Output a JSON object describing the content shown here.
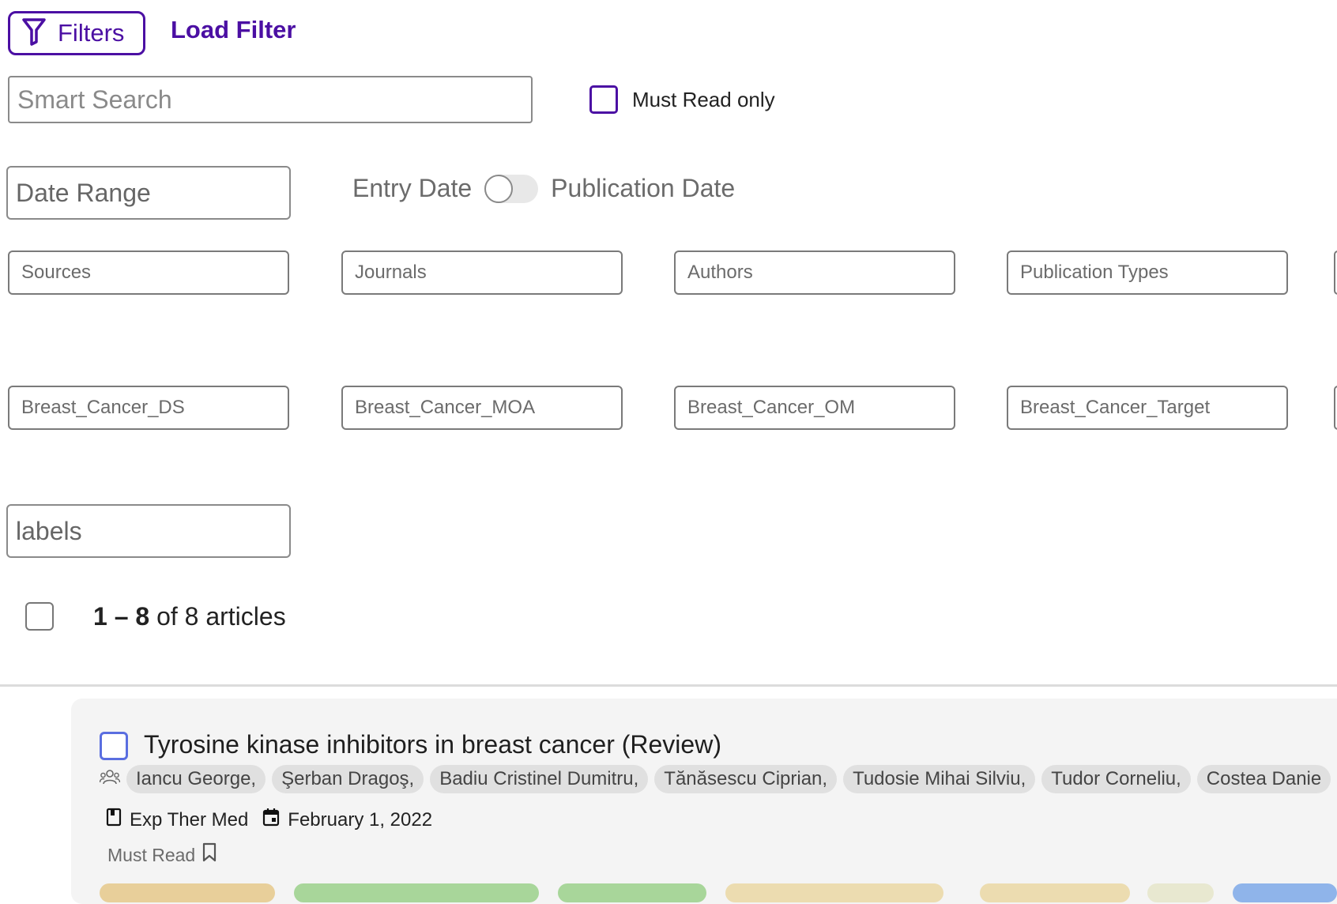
{
  "header": {
    "filters_label": "Filters",
    "load_filter_label": "Load Filter"
  },
  "search": {
    "placeholder": "Smart Search",
    "must_read_only_label": "Must Read only"
  },
  "date": {
    "range_label": "Date Range",
    "entry_date_label": "Entry Date",
    "publication_date_label": "Publication Date"
  },
  "filters": {
    "row1": [
      "Sources",
      "Journals",
      "Authors",
      "Publication Types"
    ],
    "row2": [
      "Breast_Cancer_DS",
      "Breast_Cancer_MOA",
      "Breast_Cancer_OM",
      "Breast_Cancer_Target"
    ],
    "labels": "labels"
  },
  "results": {
    "range": "1 – 8",
    "total_text": "of 8 articles"
  },
  "article": {
    "title": "Tyrosine kinase inhibitors in breast cancer (Review)",
    "authors": [
      "Iancu George,",
      "Şerban Dragoş,",
      "Badiu Cristinel Dumitru,",
      "Tănăsescu Ciprian,",
      "Tudosie Mihai Silviu,",
      "Tudor Corneliu,",
      "Costea Danie"
    ],
    "journal": "Exp Ther Med",
    "date": "February 1, 2022",
    "must_read_label": "Must Read"
  },
  "colors": {
    "accent": "#4b0fa3",
    "checkbox_blue": "#5a6ee0",
    "card_bg": "#f4f4f4",
    "tag_colors": [
      "#e8cf9a",
      "#a8d69a",
      "#a8d69a",
      "#ecdcb0",
      "#ecdcb0",
      "#e8e8d0",
      "#8fb4ea"
    ]
  },
  "icons": {
    "filter": "funnel-icon",
    "authors": "people-icon",
    "journal": "journal-icon",
    "date": "calendar-icon",
    "must_read": "bookmark-icon"
  }
}
